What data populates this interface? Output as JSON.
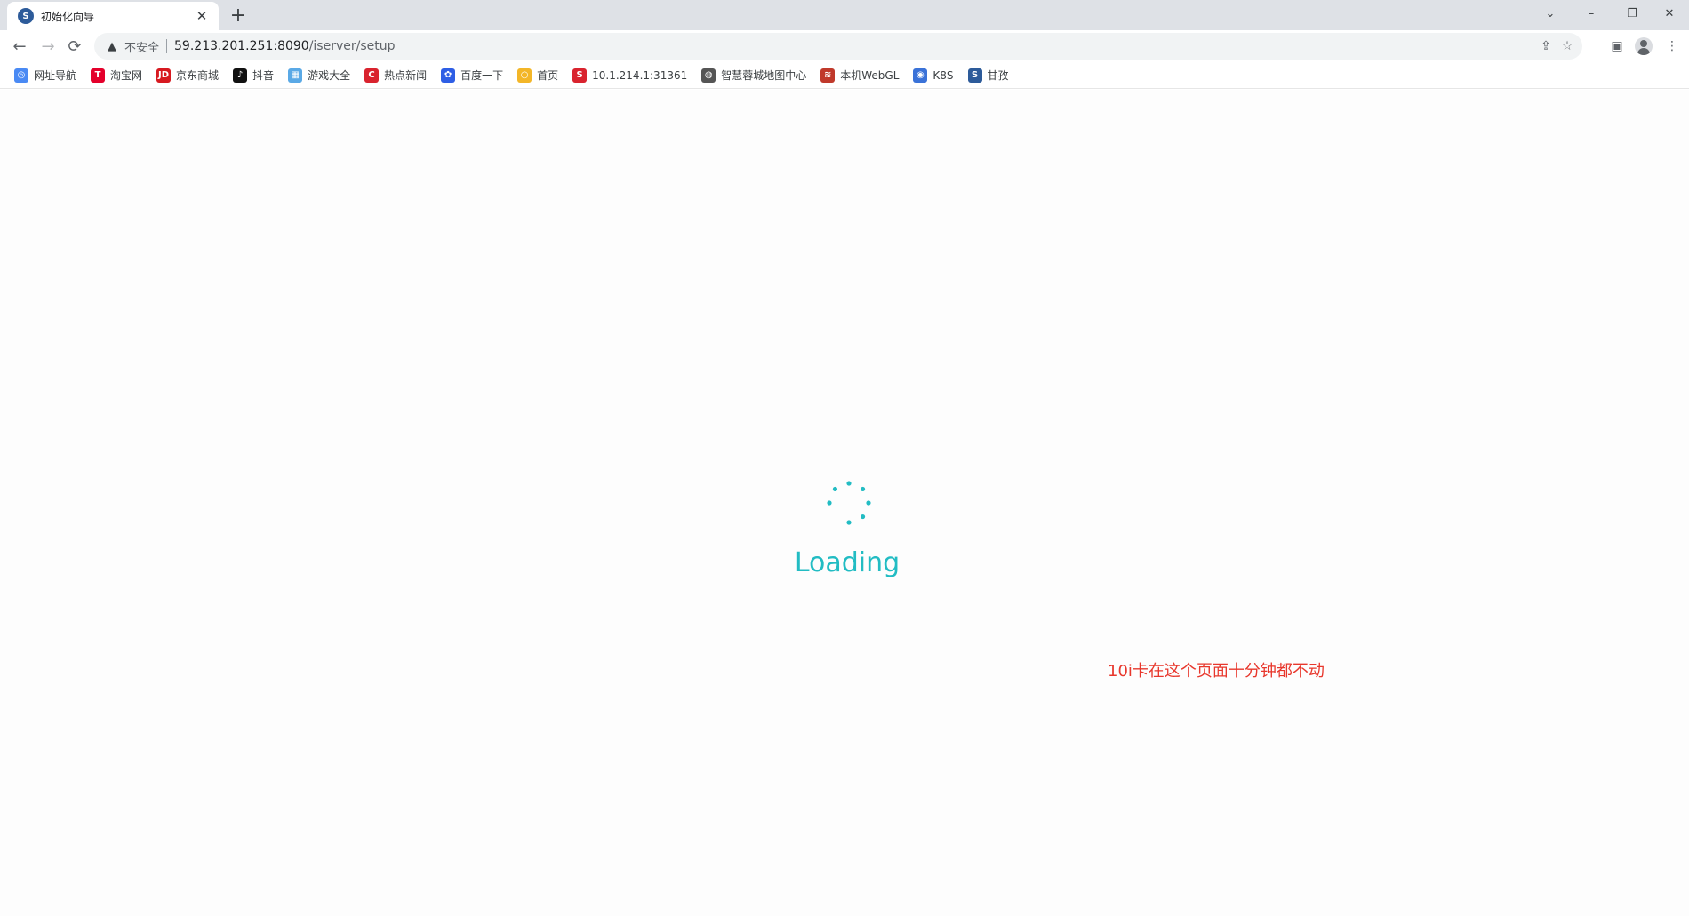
{
  "browser": {
    "tab": {
      "title": "初始化向导",
      "favicon": "supermap-icon",
      "close": "✕"
    },
    "new_tab": "+",
    "window_controls": {
      "dropdown": "⌄",
      "minimize": "–",
      "restore": "❐",
      "close": "✕"
    }
  },
  "toolbar": {
    "back": "←",
    "forward": "→",
    "reload": "⟳",
    "security_label": "不安全",
    "url_host": "59.213.201.251:8090",
    "url_path": "/iserver/setup"
  },
  "bookmarks": [
    {
      "label": "网址导航",
      "icon": "globe-icon",
      "color": "#4a8af4",
      "glyph": "◎"
    },
    {
      "label": "淘宝网",
      "icon": "taobao-icon",
      "color": "#e4002b",
      "glyph": "T"
    },
    {
      "label": "京东商城",
      "icon": "jd-icon",
      "color": "#d71920",
      "glyph": "JD"
    },
    {
      "label": "抖音",
      "icon": "douyin-icon",
      "color": "#111111",
      "glyph": "♪"
    },
    {
      "label": "游戏大全",
      "icon": "game-icon",
      "color": "#5aa9e6",
      "glyph": "▦"
    },
    {
      "label": "热点新闻",
      "icon": "news-icon",
      "color": "#d9232e",
      "glyph": "C"
    },
    {
      "label": "百度一下",
      "icon": "baidu-icon",
      "color": "#2e5ee5",
      "glyph": "✿"
    },
    {
      "label": "首页",
      "icon": "home-icon",
      "color": "#f3b628",
      "glyph": "○"
    },
    {
      "label": "10.1.214.1:31361",
      "icon": "s-icon",
      "color": "#d9232e",
      "glyph": "S"
    },
    {
      "label": "智慧蓉城地图中心",
      "icon": "globe-dark-icon",
      "color": "#555555",
      "glyph": "◍"
    },
    {
      "label": "本机WebGL",
      "icon": "webgl-icon",
      "color": "#c0392b",
      "glyph": "≋"
    },
    {
      "label": "K8S",
      "icon": "k8s-icon",
      "color": "#3a72d8",
      "glyph": "◉"
    },
    {
      "label": "甘孜",
      "icon": "supermap-icon",
      "color": "#2d5b9a",
      "glyph": "S"
    }
  ],
  "page": {
    "loading_text": "Loading",
    "note": "10i卡在这个页面十分钟都不动"
  },
  "colors": {
    "spinner": "#22bcc3",
    "note": "#e8372c"
  }
}
